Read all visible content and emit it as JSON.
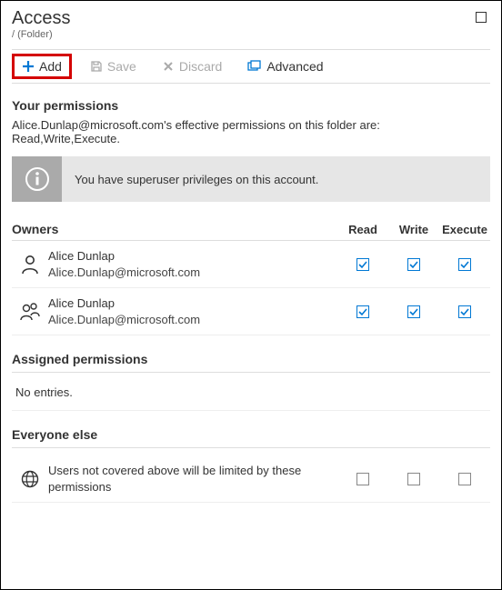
{
  "header": {
    "title": "Access",
    "breadcrumb": "/ (Folder)"
  },
  "toolbar": {
    "add": "Add",
    "save": "Save",
    "discard": "Discard",
    "advanced": "Advanced"
  },
  "your_permissions": {
    "heading": "Your permissions",
    "summary": "Alice.Dunlap@microsoft.com's effective permissions on this folder are: Read,Write,Execute.",
    "banner": "You have superuser privileges on this account."
  },
  "columns": {
    "read": "Read",
    "write": "Write",
    "execute": "Execute"
  },
  "owners": {
    "heading": "Owners",
    "rows": [
      {
        "name": "Alice Dunlap",
        "email": "Alice.Dunlap@microsoft.com",
        "read": true,
        "write": true,
        "execute": true
      },
      {
        "name": "Alice Dunlap",
        "email": "Alice.Dunlap@microsoft.com",
        "read": true,
        "write": true,
        "execute": true
      }
    ]
  },
  "assigned": {
    "heading": "Assigned permissions",
    "empty": "No entries."
  },
  "everyone": {
    "heading": "Everyone else",
    "description": "Users not covered above will be limited by these permissions",
    "read": false,
    "write": false,
    "execute": false
  }
}
